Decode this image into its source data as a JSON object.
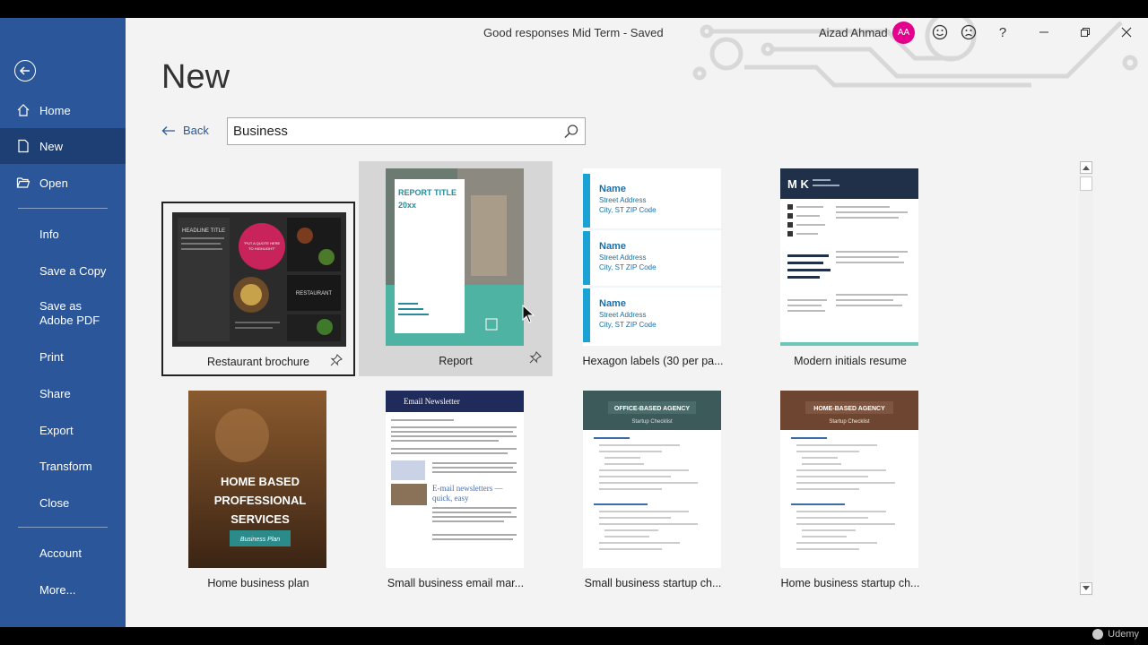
{
  "window": {
    "doc_title": "Good responses Mid Term  -  Saved",
    "user_name": "Aizad Ahmad",
    "avatar_initials": "AA",
    "help": "?"
  },
  "sidebar": {
    "items": [
      {
        "label": "Home",
        "icon": "home-icon"
      },
      {
        "label": "New",
        "icon": "new-doc-icon",
        "active": true
      },
      {
        "label": "Open",
        "icon": "folder-open-icon"
      },
      {
        "label": "Info"
      },
      {
        "label": "Save a Copy"
      },
      {
        "label": "Save as Adobe PDF"
      },
      {
        "label": "Print"
      },
      {
        "label": "Share"
      },
      {
        "label": "Export"
      },
      {
        "label": "Transform"
      },
      {
        "label": "Close"
      },
      {
        "label": "Account"
      },
      {
        "label": "More..."
      }
    ]
  },
  "main": {
    "heading": "New",
    "back_label": "Back",
    "search_value": "Business",
    "templates": [
      {
        "label": "Restaurant brochure",
        "state": "selected"
      },
      {
        "label": "Report",
        "state": "hover"
      },
      {
        "label": "Hexagon labels (30 per pa..."
      },
      {
        "label": "Modern initials resume"
      },
      {
        "label": "Home business plan"
      },
      {
        "label": "Small business email mar..."
      },
      {
        "label": "Small business startup ch..."
      },
      {
        "label": "Home business startup ch..."
      }
    ],
    "thumb_text": {
      "brochure_heading": "HEADLINE TITLE",
      "brochure_quote": "\"PUT A QUOTE HERE TO HIGHLIGHT ONE OF YOUR GREATEST IN SERVICES\"",
      "brochure_restaurant": "RESTAURANT",
      "report_title": "REPORT TITLE",
      "report_year": "20xx",
      "label_name": "Name",
      "label_street": "Street Address",
      "label_city": "City, ST ZIP Code",
      "resume_initials": "M K",
      "plan_line1": "HOME BASED",
      "plan_line2": "PROFESSIONAL",
      "plan_line3": "SERVICES",
      "plan_sub": "Business Plan",
      "newsletter_title": "Email Newsletter",
      "newsletter_head": "E-mail newsletters —",
      "newsletter_head2": "quick, easy",
      "office_title": "OFFICE-BASED AGENCY",
      "home_title": "HOME-BASED AGENCY",
      "checklist_sub": "Startup Checklist"
    }
  },
  "watermark": "Udemy"
}
